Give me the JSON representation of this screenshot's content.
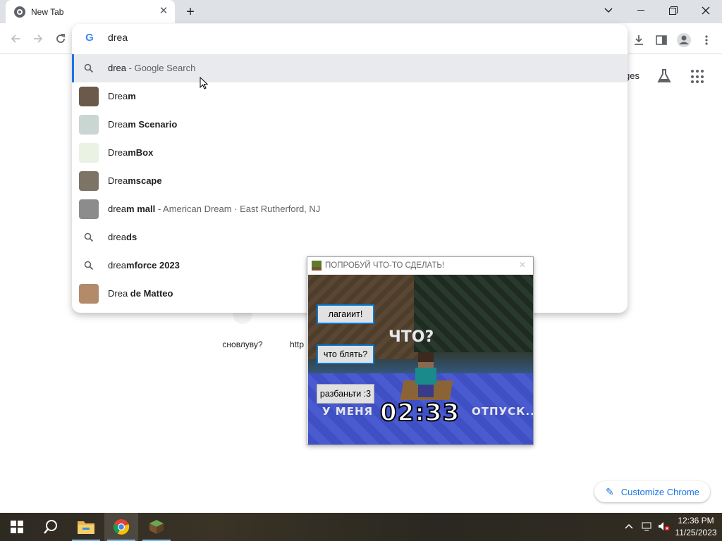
{
  "browser": {
    "tab_title": "New Tab",
    "omnibox_text": "drea",
    "images_link": "ges",
    "shortcut_label": "сновлуву?",
    "shortcut2_label": "http",
    "customize_label": "Customize Chrome"
  },
  "suggestions": [
    {
      "plain": "drea",
      "bold": "",
      "sub": " - Google Search",
      "icon": "search-icon"
    },
    {
      "plain": "Drea",
      "bold": "m",
      "sub": "",
      "icon": "thumbnail-dream"
    },
    {
      "plain": "Drea",
      "bold": "m Scenario",
      "sub": "",
      "icon": "thumbnail-dream-scenario"
    },
    {
      "plain": "Drea",
      "bold": "mBox",
      "sub": "",
      "icon": "thumbnail-dreambox"
    },
    {
      "plain": "Drea",
      "bold": "mscape",
      "sub": "",
      "icon": "thumbnail-dreamscape"
    },
    {
      "plain": "drea",
      "bold": "m mall",
      "sub": " - American Dream · East Rutherford, NJ",
      "icon": "thumbnail-dream-mall"
    },
    {
      "plain": "drea",
      "bold": "ds",
      "sub": "",
      "icon": "search-icon"
    },
    {
      "plain": "drea",
      "bold": "mforce 2023",
      "sub": "",
      "icon": "search-icon"
    },
    {
      "plain": "Drea ",
      "bold": "de Matteo",
      "sub": "",
      "icon": "thumbnail-drea-de-matteo"
    }
  ],
  "popup": {
    "title": "ПОПРОБУЙ ЧТО-ТО СДЕЛАТЬ!",
    "buttons": [
      "лагаиит!",
      "что блять?",
      "разбаньти :3"
    ],
    "overlay_text": "ЧТО?",
    "caption_left": "У МЕНЯ",
    "caption_right": "ОТПУСК...",
    "timer": "02:33"
  },
  "taskbar": {
    "time": "12:36 PM",
    "date": "11/25/2023"
  },
  "colors": {
    "accent": "#1a73e8",
    "tabstrip": "#dee1e6",
    "selected_row": "#e8eaed"
  }
}
